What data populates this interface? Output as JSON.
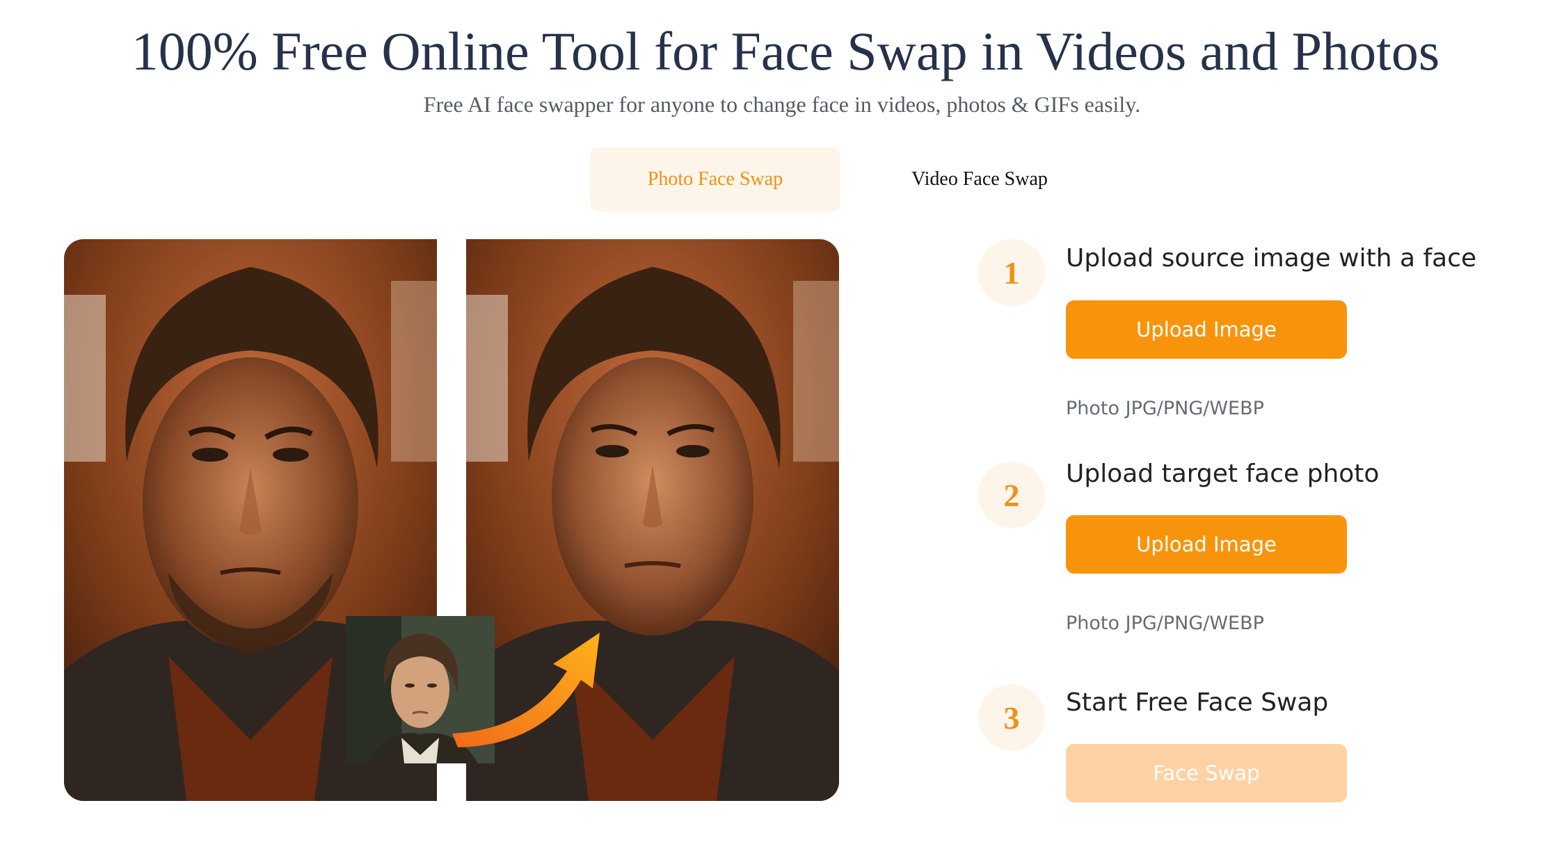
{
  "header": {
    "title": "100% Free Online Tool for Face Swap in Videos and Photos",
    "subtitle": "Free AI face swapper for anyone to change face in videos, photos & GIFs easily."
  },
  "tabs": [
    {
      "label": "Photo Face Swap",
      "active": true
    },
    {
      "label": "Video Face Swap",
      "active": false
    }
  ],
  "steps": [
    {
      "number": "1",
      "title": "Upload source image with a face",
      "button": "Upload Image",
      "hint": "Photo JPG/PNG/WEBP"
    },
    {
      "number": "2",
      "title": "Upload target face photo",
      "button": "Upload Image",
      "hint": "Photo JPG/PNG/WEBP"
    },
    {
      "number": "3",
      "title": "Start Free Face Swap",
      "button": "Face Swap",
      "disabled": true
    }
  ],
  "colors": {
    "accent": "#f8940c",
    "accent_light": "#fef5ea",
    "disabled_button": "#fed2a4",
    "title": "#26324a"
  },
  "icons": {
    "arrow": "curved-arrow-icon"
  }
}
